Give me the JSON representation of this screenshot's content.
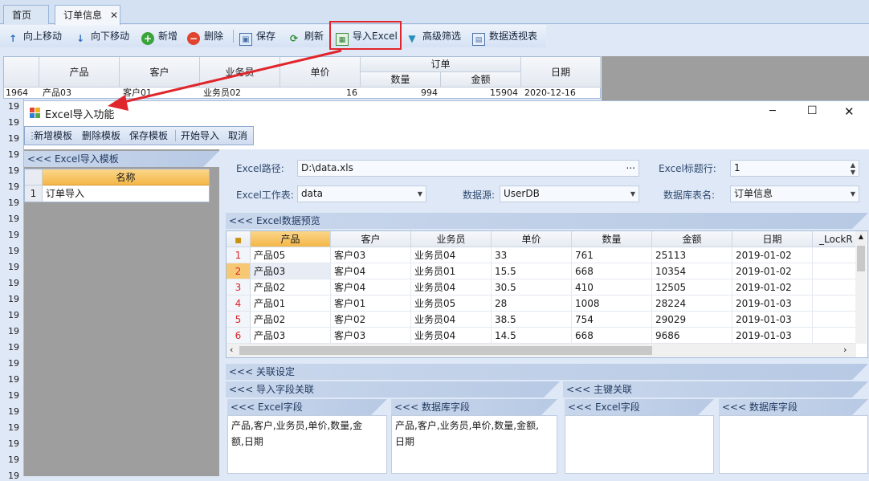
{
  "tabs": [
    {
      "label": "首页"
    },
    {
      "label": "订单信息",
      "close": "✕"
    }
  ],
  "toolbar": {
    "move_up": "向上移动",
    "move_down": "向下移动",
    "add": "新增",
    "delete": "删除",
    "save": "保存",
    "refresh": "刷新",
    "import_excel": "导入Excel",
    "advanced_filter": "高级筛选",
    "pivot": "数据透视表"
  },
  "back_grid": {
    "headers": {
      "product": "产品",
      "customer": "客户",
      "salesman": "业务员",
      "price": "单价",
      "order": "订单",
      "qty": "数量",
      "amount": "金额",
      "date": "日期"
    },
    "row": {
      "num": "1964",
      "product": "产品03",
      "customer": "客户01",
      "salesman": "业务员02",
      "price": "16",
      "qty": "994",
      "amount": "15904",
      "date": "2020-12-16"
    },
    "row_numbers": [
      "19",
      "19",
      "19",
      "19",
      "19",
      "19",
      "19",
      "19",
      "19",
      "19",
      "19",
      "19",
      "19",
      "19",
      "19",
      "19",
      "19",
      "19",
      "19",
      "19",
      "19",
      "19",
      "19",
      "19"
    ]
  },
  "dialog": {
    "title": "Excel导入功能",
    "controls": {
      "minimize": "─",
      "maximize": "☐",
      "close": "✕"
    },
    "toolbar": {
      "new_template": "新增模板",
      "delete_template": "删除模板",
      "save_template": "保存模板",
      "start_import": "开始导入",
      "cancel": "取消"
    },
    "template_panel": {
      "title": "<<< Excel导入模板",
      "header": "名称",
      "rows": [
        {
          "num": "1",
          "name": "订单导入"
        }
      ]
    },
    "form": {
      "excel_path_label": "Excel路径:",
      "excel_path": "D:\\data.xls",
      "browse": "...",
      "header_row_label": "Excel标题行:",
      "header_row": "1",
      "sheet_label": "Excel工作表:",
      "sheet": "data",
      "datasource_label": "数据源:",
      "datasource": "UserDB",
      "table_label": "数据库表名:",
      "table": "订单信息"
    },
    "preview": {
      "title": "<<< Excel数据预览",
      "columns": [
        "产品",
        "客户",
        "业务员",
        "单价",
        "数量",
        "金额",
        "日期",
        "_LockR"
      ],
      "rows": [
        {
          "num": "1",
          "cells": [
            "产品05",
            "客户03",
            "业务员04",
            "33",
            "761",
            "25113",
            "2019-01-02"
          ]
        },
        {
          "num": "2",
          "cells": [
            "产品03",
            "客户04",
            "业务员01",
            "15.5",
            "668",
            "10354",
            "2019-01-02"
          ]
        },
        {
          "num": "3",
          "cells": [
            "产品02",
            "客户04",
            "业务员04",
            "30.5",
            "410",
            "12505",
            "2019-01-02"
          ]
        },
        {
          "num": "4",
          "cells": [
            "产品01",
            "客户01",
            "业务员05",
            "28",
            "1008",
            "28224",
            "2019-01-03"
          ]
        },
        {
          "num": "5",
          "cells": [
            "产品02",
            "客户02",
            "业务员04",
            "38.5",
            "754",
            "29029",
            "2019-01-03"
          ]
        },
        {
          "num": "6",
          "cells": [
            "产品03",
            "客户03",
            "业务员04",
            "14.5",
            "668",
            "9686",
            "2019-01-03"
          ]
        }
      ]
    },
    "relation": {
      "title": "<<< 关联设定",
      "field_mapping": "<<< 导入字段关联",
      "key_mapping": "<<< 主键关联",
      "excel_fields_title": "<<< Excel字段",
      "db_fields_title": "<<< 数据库字段",
      "excel_fields": "产品,客户,业务员,单价,数量,金额,日期",
      "db_fields": "产品,客户,业务员,单价,数量,金额,日期",
      "key_excel_title": "<<< Excel字段",
      "key_db_title": "<<< 数据库字段"
    }
  }
}
